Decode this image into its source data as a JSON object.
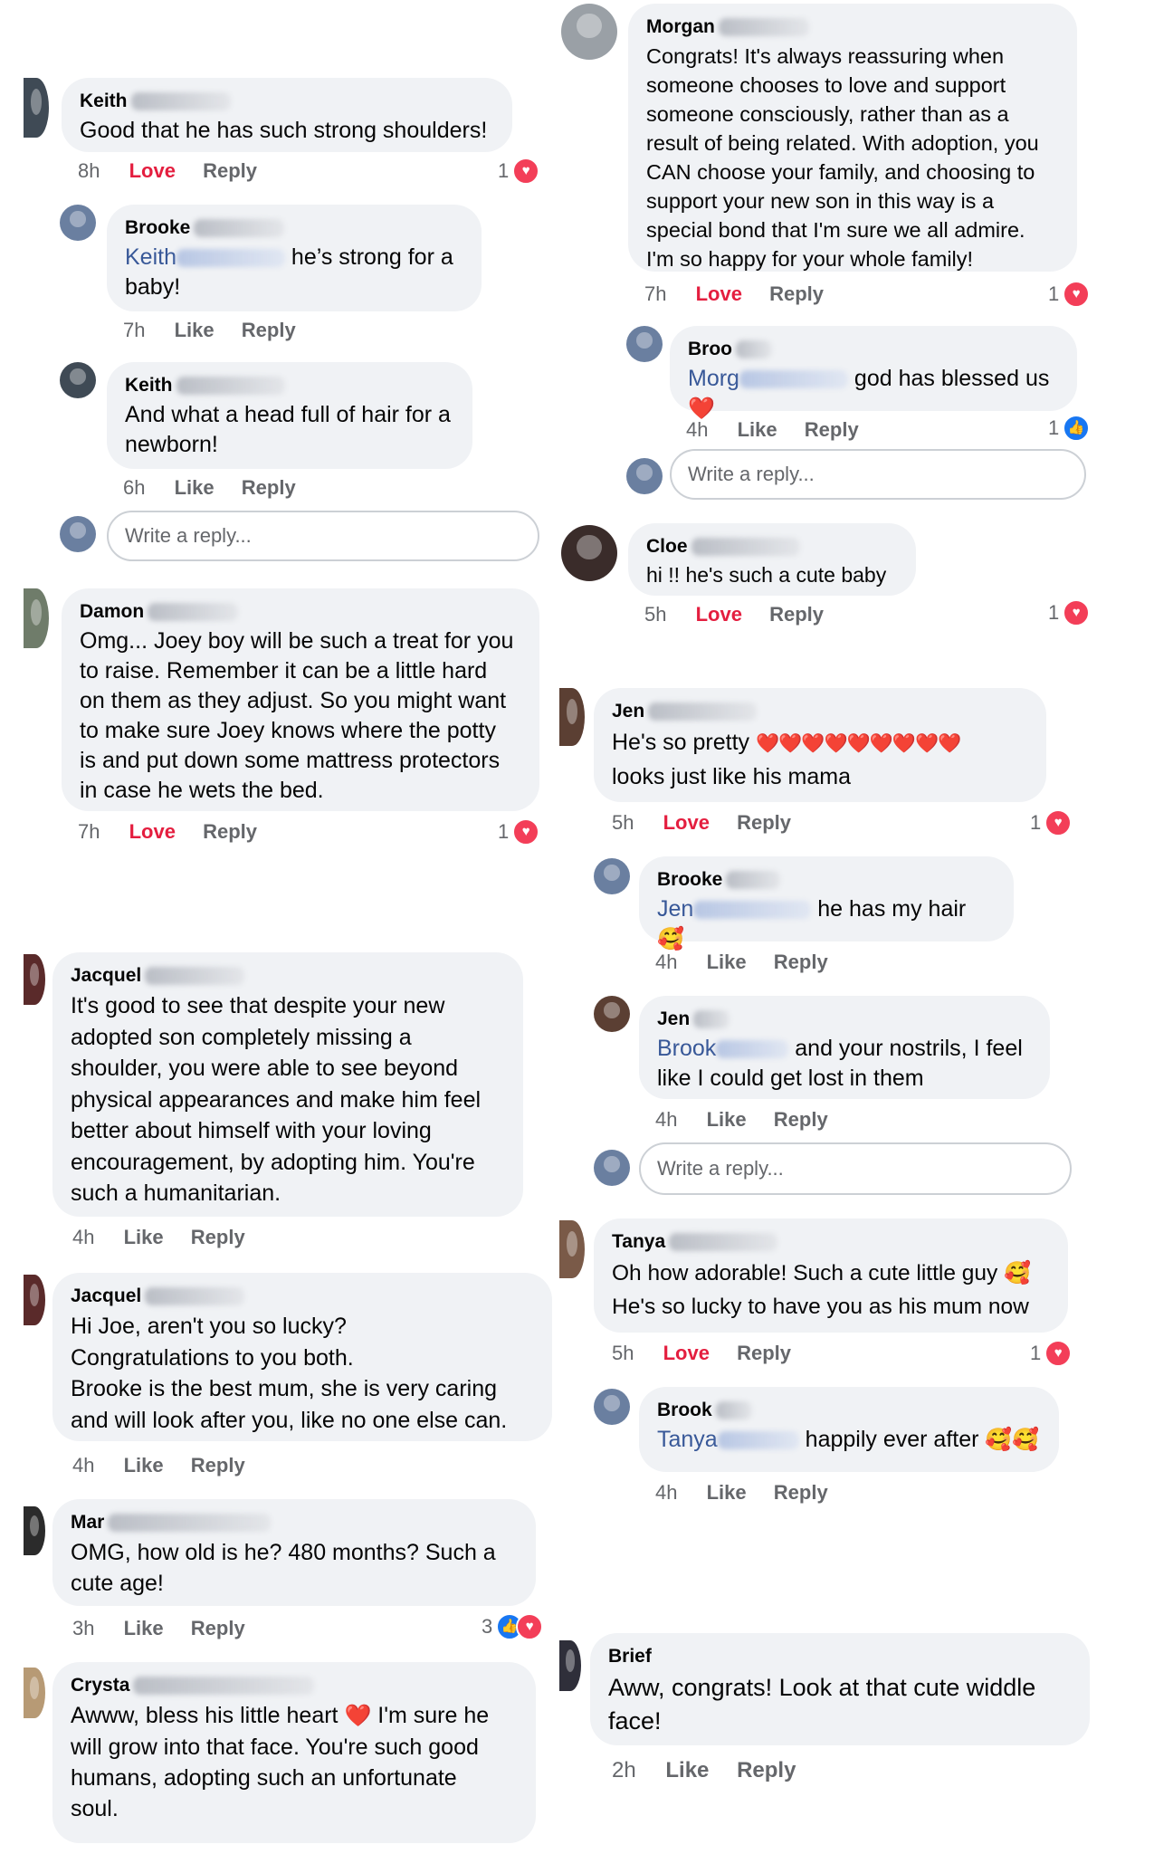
{
  "actions": {
    "like": "Like",
    "love": "Love",
    "reply": "Reply"
  },
  "write_reply_placeholder": "Write a reply...",
  "left": [
    {
      "name": "Keith",
      "text": "Good that he has such strong shoulders!",
      "time": "8h",
      "reaction_count": "1"
    },
    {
      "name": "Brooke",
      "mention": "Keith",
      "text": " he’s strong for a\nbaby!",
      "time": "7h"
    },
    {
      "name": "Keith",
      "text": "And what a head full of hair for a\nnewborn!",
      "time": "6h"
    },
    {
      "name": "Damon",
      "text": "Omg... Joey boy will be such a treat for you\nto raise.  Remember it can be a little hard\non them as they adjust. So you might want\nto make sure Joey knows where the potty\nis and put down some mattress protectors\nin case he wets the bed.",
      "time": "7h",
      "reaction_count": "1"
    },
    {
      "name": "Jacquel",
      "text": "It's good to see that despite your new\nadopted son completely missing a\nshoulder, you were able to see beyond\nphysical appearances and make him feel\nbetter about himself with your loving\nencouragement, by adopting him. You're\nsuch a humanitarian.",
      "time": "4h"
    },
    {
      "name": "Jacquel",
      "text": "Hi Joe, aren't you so lucky?\nCongratulations to you both.\nBrooke is the best  mum, she is very caring\nand will look after you, like no one else can.",
      "time": "4h"
    },
    {
      "name": "Mar",
      "text": "OMG, how old is he? 480 months? Such a\ncute age!",
      "time": "3h",
      "reaction_count": "3"
    },
    {
      "name": "Crysta",
      "text_a": "Awww, bless his little heart ",
      "text_b": " I'm sure he\nwill grow into that face.  You're such good\nhumans, adopting such an unfortunate\nsoul.",
      "heart": "❤️"
    }
  ],
  "right": [
    {
      "name": "Morgan",
      "text": "Congrats! It's always reassuring when\nsomeone chooses to love and support\nsomeone consciously, rather than as a\nresult of being related. With adoption, you\nCAN choose your family, and choosing to\nsupport your new son in this way is a\nspecial bond that I'm sure we all admire.\nI'm so happy for your whole family!",
      "time": "7h",
      "reaction_count": "1"
    },
    {
      "name": "Broo",
      "mention": "Morg",
      "text": " god has blessed us ",
      "heart": "❤️",
      "time": "4h",
      "reaction_count": "1"
    },
    {
      "name": "Cloe",
      "text": "hi !! he's such a cute baby",
      "time": "5h",
      "reaction_count": "1"
    },
    {
      "name": "Jen",
      "text_a": "He's so pretty ",
      "hearts": "❤️❤️❤️❤️❤️❤️❤️❤️❤️",
      "text_b": "\nlooks just like his mama",
      "time": "5h",
      "reaction_count": "1"
    },
    {
      "name": "Brooke",
      "mention": "Jen",
      "text": " he has my hair ",
      "emoji": "🥰",
      "time": "4h"
    },
    {
      "name": "Jen",
      "mention": "Brook",
      "text": " and your nostrils, I feel\nlike I could get lost in them",
      "time": "4h"
    },
    {
      "name": "Tanya",
      "text": "Oh how adorable! Such a cute little guy ",
      "emoji": "🥰",
      "text_b": "\nHe's so lucky to have you as his mum now",
      "time": "5h",
      "reaction_count": "1"
    },
    {
      "name": "Brook",
      "mention": "Tanya",
      "text": " happily ever after ",
      "emoji": "🥰🥰",
      "time": "4h"
    },
    {
      "name": "Brief",
      "text": "Aww, congrats! Look at that cute widdle\nface!",
      "time": "2h"
    }
  ]
}
